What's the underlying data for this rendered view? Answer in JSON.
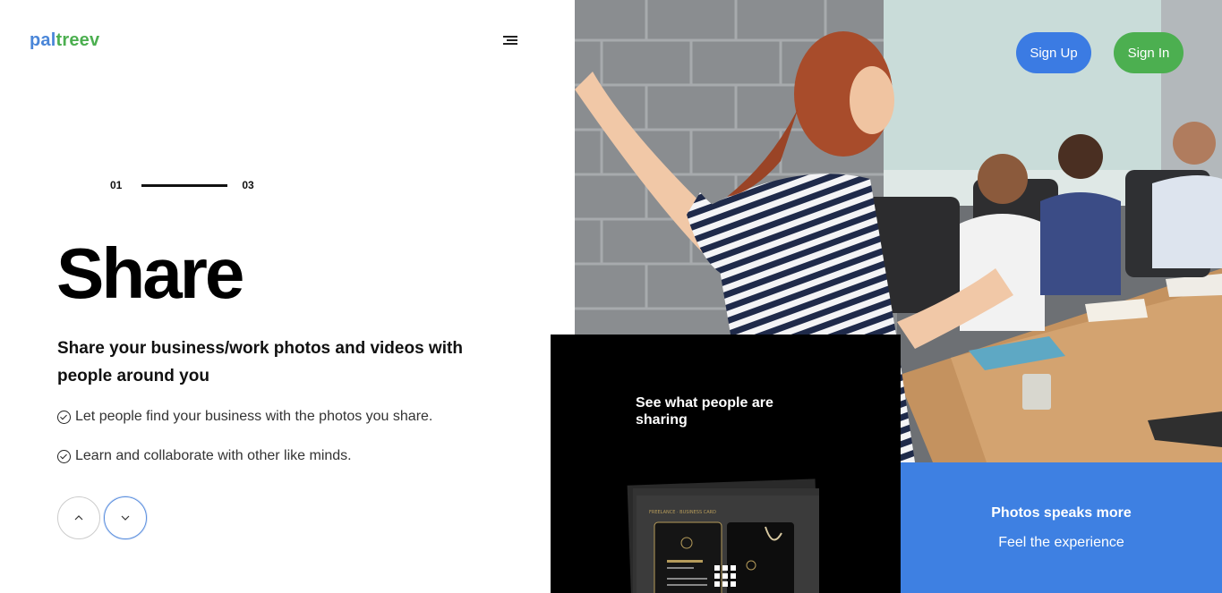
{
  "brand": {
    "part1": "pal",
    "part2": "treev"
  },
  "header": {
    "signup_label": "Sign Up",
    "signin_label": "Sign In"
  },
  "slider": {
    "current": "01",
    "total": "03"
  },
  "hero": {
    "title": "Share",
    "subtitle": "Share your business/work photos and videos with people around you",
    "bullets": [
      "Let people find your business with the photos you share.",
      "Learn and collaborate with other like minds."
    ]
  },
  "dark_card": {
    "title": "See what people are sharing"
  },
  "blue_card": {
    "title": "Photos speaks more",
    "subtitle": "Feel the experience"
  },
  "colors": {
    "brand_blue": "#4a86d8",
    "brand_green": "#4caf50",
    "signup_bg": "#3b7be3",
    "signin_bg": "#4caf50",
    "card_blue": "#3e80e2"
  },
  "icons": [
    "hamburger-menu-icon",
    "check-circle-icon",
    "chevron-up-icon",
    "chevron-down-icon",
    "grid-icon"
  ]
}
